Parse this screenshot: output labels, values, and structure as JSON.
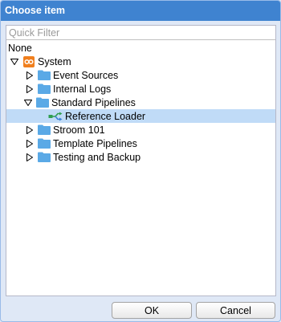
{
  "dialog": {
    "title": "Choose item",
    "filter_placeholder": "Quick Filter",
    "none_label": "None",
    "ok_label": "OK",
    "cancel_label": "Cancel"
  },
  "tree": {
    "root": {
      "label": "System",
      "icon": "system-icon",
      "expanded": true
    },
    "items": [
      {
        "label": "Event Sources",
        "icon": "folder-icon",
        "expanded": false
      },
      {
        "label": "Internal Logs",
        "icon": "folder-icon",
        "expanded": false
      },
      {
        "label": "Standard Pipelines",
        "icon": "folder-icon",
        "expanded": true
      },
      {
        "label": "Reference Loader",
        "icon": "pipeline-icon",
        "selected": true
      },
      {
        "label": "Stroom 101",
        "icon": "folder-icon",
        "expanded": false
      },
      {
        "label": "Template Pipelines",
        "icon": "folder-icon",
        "expanded": false
      },
      {
        "label": "Testing and Backup",
        "icon": "folder-icon",
        "expanded": false
      }
    ]
  },
  "colors": {
    "titlebar": "#3f83d0",
    "selection": "#c0dbf7",
    "folder": "#5aa9e6",
    "system": "#f07f1e"
  }
}
